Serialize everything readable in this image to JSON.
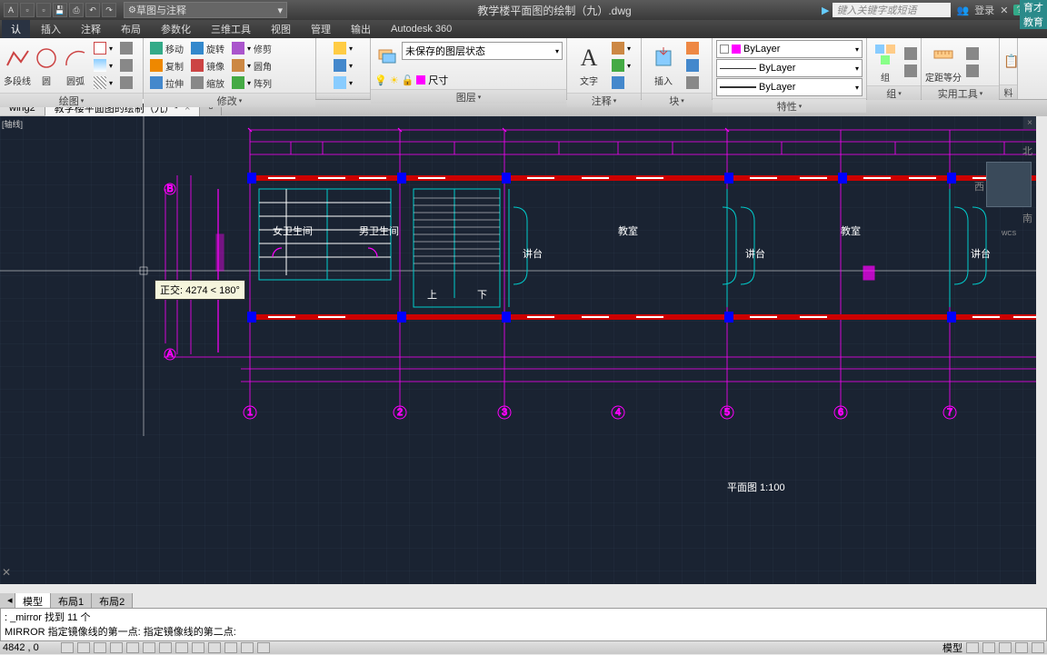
{
  "titlebar": {
    "workspace": "草图与注释",
    "doc_title": "教学楼平面图的绘制（九）.dwg",
    "search_placeholder": "键入关键字或短语",
    "login": "登录"
  },
  "menu": {
    "tabs": [
      "认",
      "插入",
      "注释",
      "布局",
      "参数化",
      "三维工具",
      "视图",
      "管理",
      "输出",
      "Autodesk 360"
    ]
  },
  "ribbon": {
    "draw": {
      "title": "绘图",
      "line": "多段线",
      "circle": "圆",
      "arc": "圆弧"
    },
    "modify": {
      "title": "修改",
      "move": "移动",
      "rotate": "旋转",
      "trim": "修剪",
      "copy": "复制",
      "mirror": "镜像",
      "fillet": "圆角",
      "stretch": "拉伸",
      "scale": "缩放",
      "array": "阵列"
    },
    "layer": {
      "title": "图层",
      "state": "未保存的图层状态",
      "dim": "尺寸"
    },
    "annot": {
      "title": "注释",
      "text": "文字"
    },
    "block": {
      "title": "块",
      "insert": "插入"
    },
    "props": {
      "title": "特性",
      "bylayer": "ByLayer"
    },
    "group": {
      "title": "组",
      "group": "组"
    },
    "util": {
      "title": "实用工具",
      "measure": "定距等分"
    }
  },
  "filetabs": {
    "t1": "wing2",
    "t2": "教学楼平面图的绘制（九）*"
  },
  "canvas": {
    "angle_label": "[轴线]",
    "tooltip": "正交: 4274 < 180°",
    "rooms": {
      "r1": "教室",
      "r2": "教室",
      "r3": "讲台",
      "r4": "讲台",
      "r5": "讲台",
      "r6": "女卫生间",
      "r7": "男卫生间",
      "up": "上",
      "down": "下",
      "scale": "平面图 1:100"
    },
    "compass": {
      "n": "北",
      "w": "西",
      "s": "南",
      "wcs": "WCS"
    }
  },
  "layout": {
    "model": "模型",
    "l1": "布局1",
    "l2": "布局2"
  },
  "cmdline": {
    "l1": ": _mirror 找到 11 个",
    "l2": "MIRROR 指定镜像线的第一点: 指定镜像线的第二点:"
  },
  "statusbar": {
    "coords": "4842 , 0",
    "right": "模型"
  },
  "brand": "育才教育"
}
